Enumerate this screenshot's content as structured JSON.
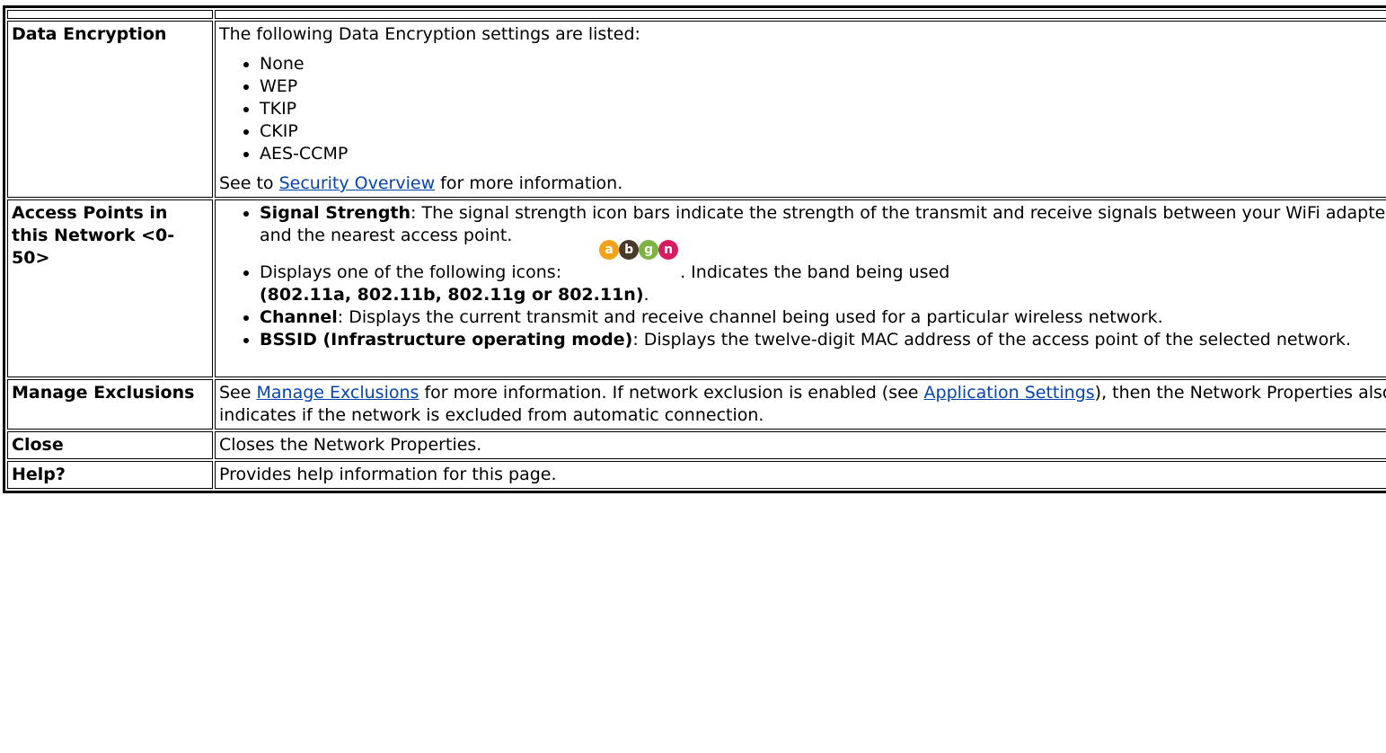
{
  "rows": [
    {
      "term": "Data Encryption",
      "intro": "The following Data Encryption settings are listed:",
      "items": [
        "None",
        "WEP",
        "TKIP",
        "CKIP",
        "AES-CCMP"
      ],
      "footer_prefix": "See to ",
      "footer_link": "Security Overview",
      "footer_suffix": " for more information."
    },
    {
      "term": "Access Points in this Network <0-50>",
      "signal_title": "Signal Strength",
      "signal_text": ": The signal strength icon bars indicate the strength of the transmit and receive signals between your WiFi adapter and the nearest access point.",
      "band_prefix": "Displays one of the following icons:",
      "band_icons": [
        "a",
        "b",
        "g",
        "n"
      ],
      "band_suffix": ". Indicates the band being used",
      "band_list": "(802.11a, 802.11b, 802.11g or 802.11n)",
      "band_end": ".",
      "channel_title": "Channel",
      "channel_text": ": Displays the current transmit and receive channel being used for a particular wireless network.",
      "bssid_title": "BSSID (Infrastructure operating mode)",
      "bssid_text": ": Displays the twelve-digit MAC address of the access point of the selected network."
    },
    {
      "term": "Manage Exclusions",
      "p1": "See ",
      "link1": "Manage Exclusions",
      "p2": " for more information. If network exclusion is enabled (see ",
      "link2": "Application Settings",
      "p3": "), then the Network Properties also indicates if the network is excluded from automatic connection."
    },
    {
      "term": "Close",
      "desc": "Closes the Network Properties."
    },
    {
      "term": "Help?",
      "desc": "Provides help information for this page."
    }
  ],
  "colors": {
    "link": "#0645ad",
    "border": "#000000"
  }
}
